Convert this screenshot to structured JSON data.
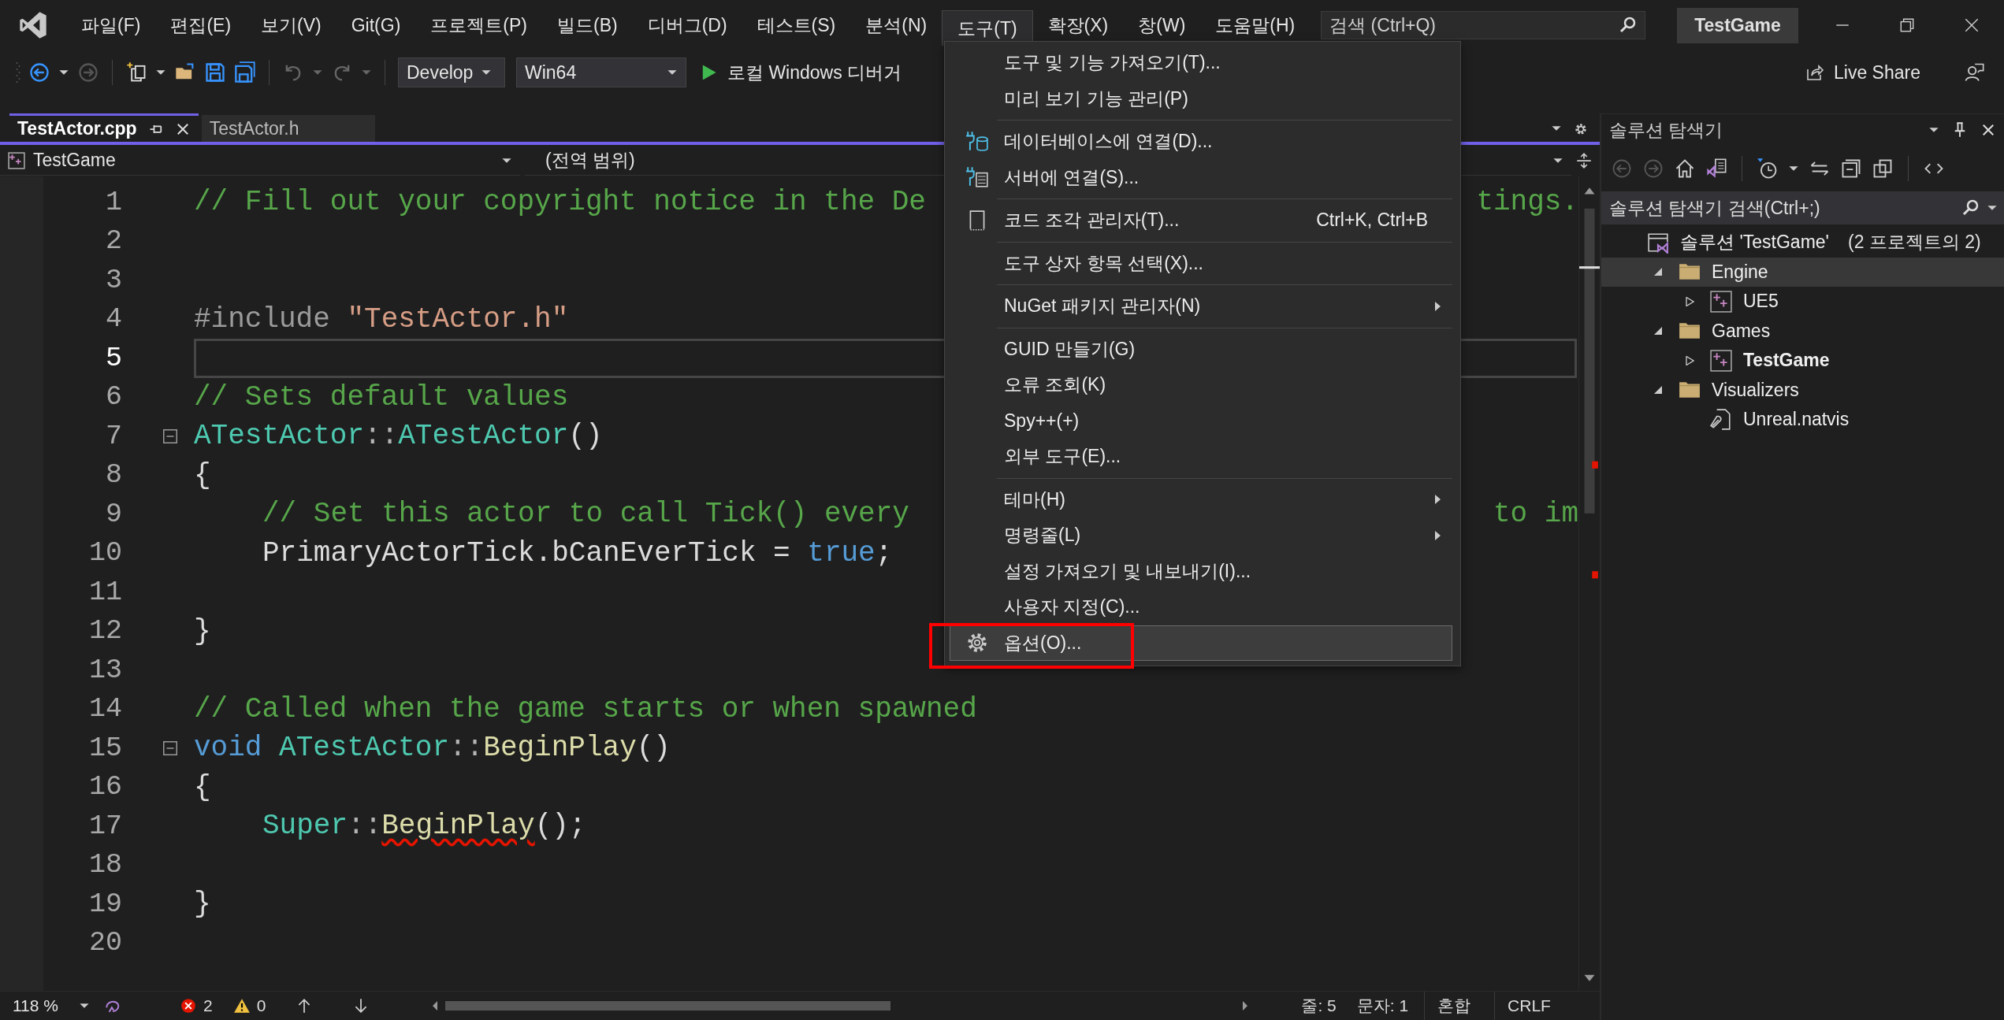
{
  "menu_bar": {
    "items": [
      {
        "label": "파일(F)",
        "selected": false
      },
      {
        "label": "편집(E)",
        "selected": false
      },
      {
        "label": "보기(V)",
        "selected": false
      },
      {
        "label": "Git(G)",
        "selected": false
      },
      {
        "label": "프로젝트(P)",
        "selected": false
      },
      {
        "label": "빌드(B)",
        "selected": false
      },
      {
        "label": "디버그(D)",
        "selected": false
      },
      {
        "label": "테스트(S)",
        "selected": false
      },
      {
        "label": "분석(N)",
        "selected": false
      },
      {
        "label": "도구(T)",
        "selected": true
      },
      {
        "label": "확장(X)",
        "selected": false
      },
      {
        "label": "창(W)",
        "selected": false
      },
      {
        "label": "도움말(H)",
        "selected": false
      }
    ],
    "search": {
      "placeholder": "검색 (Ctrl+Q)"
    },
    "solution_name": "TestGame"
  },
  "toolbar": {
    "configuration": "Develop",
    "platform": "Win64",
    "run_label": "로컬 Windows 디버거",
    "live_share": "Live Share"
  },
  "tabs": [
    {
      "label": "TestActor.cpp",
      "selected": true
    },
    {
      "label": "TestActor.h",
      "selected": false
    }
  ],
  "nav_bar": {
    "project": "TestGame",
    "scope": "(전역 범위)"
  },
  "code_lines": [
    {
      "number": "1",
      "current": false,
      "fold": false,
      "indented": false,
      "tokens": [
        {
          "kind": "comment",
          "text": "// Fill out your copyright notice in the De"
        }
      ],
      "tail": [
        {
          "kind": "comment",
          "text": "tings."
        }
      ]
    },
    {
      "number": "2",
      "current": false,
      "fold": false
    },
    {
      "number": "3",
      "current": false,
      "fold": false
    },
    {
      "number": "4",
      "current": false,
      "fold": false,
      "indented": false,
      "tokens": [
        {
          "kind": "preproc",
          "text": "#include "
        },
        {
          "kind": "string",
          "text": "\"TestActor.h\""
        }
      ]
    },
    {
      "number": "5",
      "current": true,
      "fold": false
    },
    {
      "number": "6",
      "current": false,
      "fold": false,
      "indented": false,
      "tokens": [
        {
          "kind": "comment",
          "text": "// Sets default values"
        }
      ]
    },
    {
      "number": "7",
      "current": false,
      "fold": true,
      "indented": false,
      "tokens": [
        {
          "kind": "type",
          "text": "ATestActor"
        },
        {
          "kind": "punct",
          "text": "::"
        },
        {
          "kind": "type",
          "text": "ATestActor"
        },
        {
          "kind": "plain",
          "text": "()"
        }
      ]
    },
    {
      "number": "8",
      "current": false,
      "fold": false,
      "indented": false,
      "tokens": [
        {
          "kind": "plain",
          "text": "{"
        }
      ]
    },
    {
      "number": "9",
      "current": false,
      "fold": false,
      "indented": true,
      "tokens": [
        {
          "kind": "comment",
          "text": "// Set this actor to call Tick() every"
        }
      ],
      "tail": [
        {
          "kind": "comment",
          "text": "to im"
        }
      ]
    },
    {
      "number": "10",
      "current": false,
      "fold": false,
      "indented": true,
      "tokens": [
        {
          "kind": "plain",
          "text": "PrimaryActorTick.bCanEverTick = "
        },
        {
          "kind": "keyword",
          "text": "true"
        },
        {
          "kind": "plain",
          "text": ";"
        }
      ]
    },
    {
      "number": "11",
      "current": false,
      "fold": false
    },
    {
      "number": "12",
      "current": false,
      "fold": false,
      "indented": false,
      "tokens": [
        {
          "kind": "plain",
          "text": "}"
        }
      ]
    },
    {
      "number": "13",
      "current": false,
      "fold": false
    },
    {
      "number": "14",
      "current": false,
      "fold": false,
      "indented": false,
      "tokens": [
        {
          "kind": "comment",
          "text": "// Called when the game starts or when spawned"
        }
      ]
    },
    {
      "number": "15",
      "current": false,
      "fold": true,
      "indented": false,
      "tokens": [
        {
          "kind": "keyword",
          "text": "void "
        },
        {
          "kind": "type",
          "text": "ATestActor"
        },
        {
          "kind": "punct",
          "text": "::"
        },
        {
          "kind": "func",
          "text": "BeginPlay"
        },
        {
          "kind": "plain",
          "text": "()"
        }
      ]
    },
    {
      "number": "16",
      "current": false,
      "fold": false,
      "indented": false,
      "tokens": [
        {
          "kind": "plain",
          "text": "{"
        }
      ]
    },
    {
      "number": "17",
      "current": false,
      "fold": false,
      "indented": true,
      "tokens": [
        {
          "kind": "type",
          "text": "Super"
        },
        {
          "kind": "punct",
          "text": "::"
        },
        {
          "kind": "func-error",
          "text": "BeginPlay"
        },
        {
          "kind": "plain",
          "text": "();"
        }
      ]
    },
    {
      "number": "18",
      "current": false,
      "fold": false
    },
    {
      "number": "19",
      "current": false,
      "fold": false,
      "indented": false,
      "tokens": [
        {
          "kind": "plain",
          "text": "}"
        }
      ]
    },
    {
      "number": "20",
      "current": false,
      "fold": false
    }
  ],
  "tools_menu": [
    {
      "kind": "item",
      "label": "도구 및 기능 가져오기(T)...",
      "submenu": false,
      "highlighted": false,
      "annotated": false
    },
    {
      "kind": "item",
      "label": "미리 보기 기능 관리(P)",
      "submenu": false,
      "highlighted": false,
      "annotated": false
    },
    {
      "kind": "separator"
    },
    {
      "kind": "database",
      "label": "데이터베이스에 연결(D)...",
      "submenu": false,
      "highlighted": false,
      "annotated": false
    },
    {
      "kind": "server",
      "label": "서버에 연결(S)...",
      "submenu": false,
      "highlighted": false,
      "annotated": false
    },
    {
      "kind": "separator"
    },
    {
      "kind": "snippet",
      "label": "코드 조각 관리자(T)...",
      "shortcut": "Ctrl+K, Ctrl+B",
      "submenu": false,
      "highlighted": false,
      "annotated": false
    },
    {
      "kind": "separator"
    },
    {
      "kind": "item",
      "label": "도구 상자 항목 선택(X)...",
      "submenu": false,
      "highlighted": false,
      "annotated": false
    },
    {
      "kind": "separator"
    },
    {
      "kind": "item",
      "label": "NuGet 패키지 관리자(N)",
      "submenu": true,
      "highlighted": false,
      "annotated": false
    },
    {
      "kind": "separator"
    },
    {
      "kind": "item",
      "label": "GUID 만들기(G)",
      "submenu": false,
      "highlighted": false,
      "annotated": false
    },
    {
      "kind": "item",
      "label": "오류 조회(K)",
      "submenu": false,
      "highlighted": false,
      "annotated": false
    },
    {
      "kind": "item",
      "label": "Spy++(+)",
      "submenu": false,
      "highlighted": false,
      "annotated": false
    },
    {
      "kind": "item",
      "label": "외부 도구(E)...",
      "submenu": false,
      "highlighted": false,
      "annotated": false
    },
    {
      "kind": "separator"
    },
    {
      "kind": "item",
      "label": "테마(H)",
      "submenu": true,
      "highlighted": false,
      "annotated": false
    },
    {
      "kind": "item",
      "label": "명령줄(L)",
      "submenu": true,
      "highlighted": false,
      "annotated": false
    },
    {
      "kind": "item",
      "label": "설정 가져오기 및 내보내기(I)...",
      "submenu": false,
      "highlighted": false,
      "annotated": false
    },
    {
      "kind": "item",
      "label": "사용자 지정(C)...",
      "submenu": false,
      "highlighted": false,
      "annotated": false
    },
    {
      "kind": "settings",
      "label": "옵션(O)...",
      "submenu": false,
      "highlighted": true,
      "annotated": true
    }
  ],
  "solution_explorer": {
    "title": "솔루션 탐색기",
    "search": {
      "placeholder": "솔루션 탐색기 검색(Ctrl+;)"
    },
    "tree": [
      {
        "kind": "solution",
        "label": "솔루션 'TestGame'",
        "note": "(2 프로젝트의 2)",
        "selected": false,
        "bold": false,
        "children": [
          {
            "kind": "folder",
            "label": "Engine",
            "expanded": true,
            "selected": true,
            "bold": false,
            "children": [
              {
                "kind": "project",
                "label": "UE5",
                "expanded": false,
                "selected": false,
                "bold": false
              }
            ]
          },
          {
            "kind": "folder",
            "label": "Games",
            "expanded": true,
            "selected": false,
            "bold": false,
            "children": [
              {
                "kind": "project",
                "label": "TestGame",
                "expanded": false,
                "selected": false,
                "bold": true
              }
            ]
          },
          {
            "kind": "folder",
            "label": "Visualizers",
            "expanded": true,
            "selected": false,
            "bold": false,
            "children": [
              {
                "kind": "file",
                "label": "Unreal.natvis",
                "selected": false,
                "bold": false
              }
            ]
          }
        ]
      }
    ]
  },
  "status_bar": {
    "zoom": "118 %",
    "errors": "2",
    "warnings": "0",
    "line": "줄: 5",
    "column": "문자: 1",
    "indent": "혼합",
    "line_ending": "CRLF"
  }
}
